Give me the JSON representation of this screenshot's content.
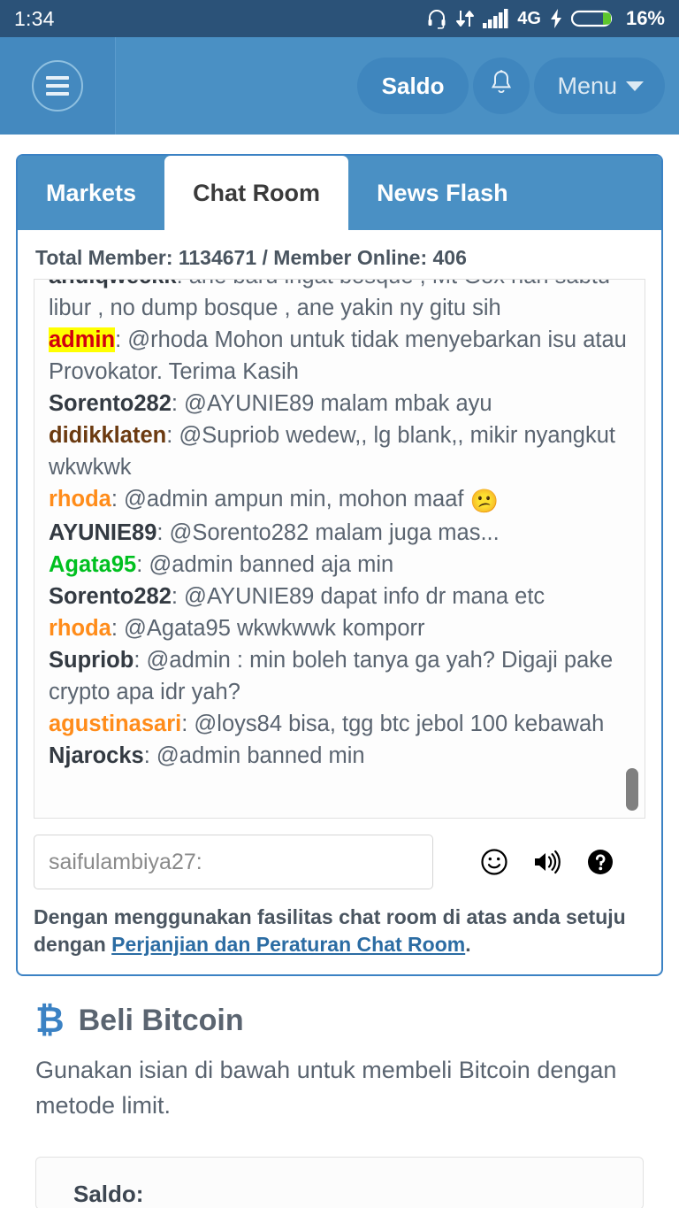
{
  "statusbar": {
    "time": "1:34",
    "network_label": "4G",
    "battery_pct": "16%",
    "icons": [
      "headset-icon",
      "data-transfer-icon",
      "signal-bars-icon",
      "charging-bolt-icon",
      "battery-icon"
    ]
  },
  "header": {
    "menu_toggle": "hamburger-icon",
    "saldo_label": "Saldo",
    "bell_label": "bell-icon",
    "menu_label": "Menu"
  },
  "tabs": [
    {
      "label": "Markets",
      "active": false
    },
    {
      "label": "Chat Room",
      "active": true
    },
    {
      "label": "News Flash",
      "active": false
    }
  ],
  "chat": {
    "member_stats": "Total Member: 1134671 / Member Online: 406",
    "messages": [
      {
        "user": "ahuiqweckk",
        "style": "u-dark",
        "text": ": ane baru ingat bosque , Mt Gox hari sabtu libur , no dump bosque , ane yakin ny gitu sih"
      },
      {
        "user": "admin",
        "style": "u-admin",
        "text": ": @rhoda Mohon untuk tidak menyebarkan isu atau Provokator. Terima Kasih"
      },
      {
        "user": "Sorento282",
        "style": "u-dark",
        "text": ": @AYUNIE89 malam mbak ayu"
      },
      {
        "user": "didikklaten",
        "style": "u-brown",
        "text": ": @Supriob wedew,, lg blank,, mikir nyangkut wkwkwk"
      },
      {
        "user": "rhoda",
        "style": "u-orange",
        "text": ": @admin ampun min, mohon maaf ",
        "emoji": "😕"
      },
      {
        "user": "AYUNIE89",
        "style": "u-dark",
        "text": ": @Sorento282 malam juga mas..."
      },
      {
        "user": "Agata95",
        "style": "u-green",
        "text": ": @admin banned aja min"
      },
      {
        "user": "Sorento282",
        "style": "u-dark",
        "text": ": @AYUNIE89 dapat info dr mana etc"
      },
      {
        "user": "rhoda",
        "style": "u-orange",
        "text": ": @Agata95 wkwkwwk komporr"
      },
      {
        "user": "Supriob",
        "style": "u-dark",
        "text": ": @admin : min boleh tanya ga yah? Digaji pake crypto apa idr yah?"
      },
      {
        "user": "agustinasari",
        "style": "u-orange",
        "text": ": @loys84 bisa, tgg btc jebol 100 kebawah"
      },
      {
        "user": "Njarocks",
        "style": "u-dark",
        "text": ": @admin banned min"
      }
    ],
    "input_placeholder": "saifulambiya27:",
    "input_value": "",
    "icons": [
      "emoji-icon",
      "sound-icon",
      "help-icon"
    ],
    "disclaimer_prefix": "Dengan menggunakan fasilitas chat room di atas anda setuju dengan ",
    "disclaimer_link": "Perjanjian dan Peraturan Chat Room",
    "disclaimer_suffix": "."
  },
  "beli": {
    "symbol": "₿",
    "title": "Beli Bitcoin",
    "description": "Gunakan isian di bawah untuk membeli Bitcoin dengan metode limit.",
    "card_label": "Saldo:"
  },
  "colors": {
    "statusbar_bg": "#2b5278",
    "header_bg": "#4a90c4",
    "tab_bg": "#4a90c4",
    "panel_border": "#3b82c4",
    "accent_link": "#2b6ca3",
    "bitcoin": "#3b82c4",
    "admin_highlight": "#ffff00",
    "admin_text": "#d1000f",
    "user_orange": "#ff8c1a",
    "user_green": "#00c020",
    "user_brown": "#6b3a10",
    "battery_green": "#5ec62e"
  }
}
